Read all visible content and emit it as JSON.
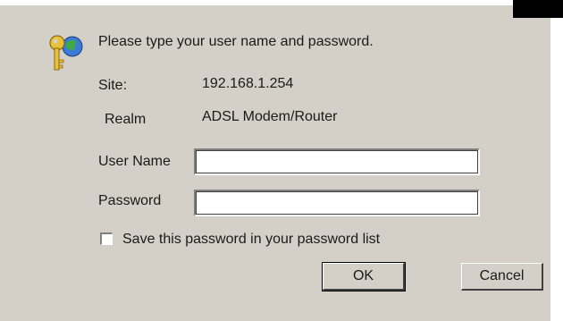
{
  "dialog": {
    "prompt": "Please type your user name and password.",
    "site_label": "Site:",
    "site_value": "192.168.1.254",
    "realm_label": "Realm",
    "realm_value": "ADSL Modem/Router",
    "username_label": "User Name",
    "username_value": "",
    "password_label": "Password",
    "password_value": "",
    "save_password_label": "Save this password in your password list",
    "save_password_checked": false,
    "ok_label": "OK",
    "cancel_label": "Cancel",
    "icon": "key-globe-icon"
  },
  "colors": {
    "dialog_bg": "#d4d0c8",
    "field_bg": "#ffffff",
    "text": "#1a1a1a"
  }
}
